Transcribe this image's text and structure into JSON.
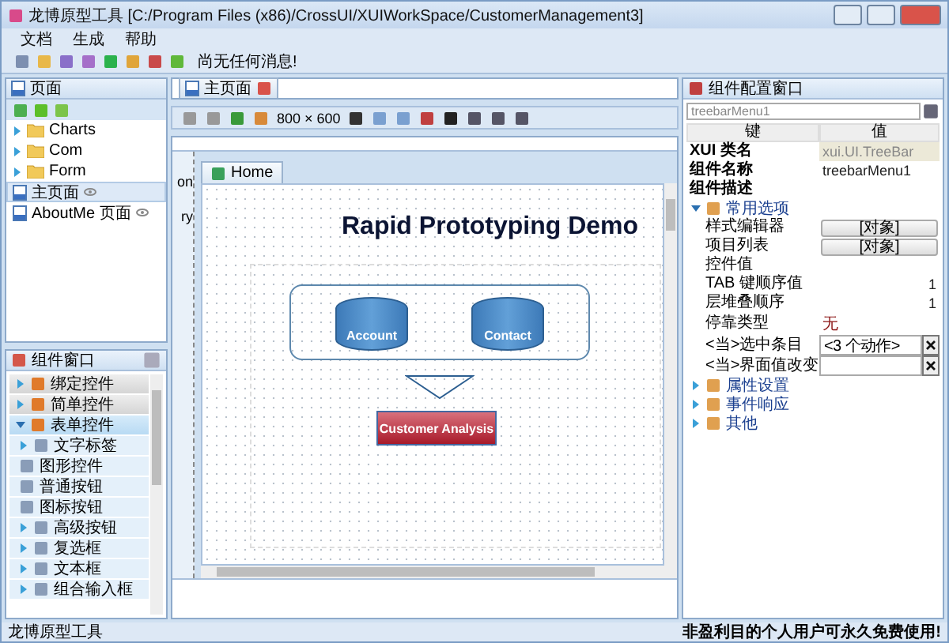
{
  "window": {
    "title": "龙博原型工具 [C:/Program Files (x86)/CrossUI/XUIWorkSpace/CustomerManagement3]"
  },
  "menu": [
    "文档",
    "生成",
    "帮助"
  ],
  "toolbar": {
    "message": "尚无任何消息!"
  },
  "pages_panel": {
    "title": "页面",
    "items": [
      {
        "kind": "folder",
        "label": "Charts",
        "expanded": false,
        "selected": false
      },
      {
        "kind": "folder",
        "label": "Com",
        "expanded": false,
        "selected": false
      },
      {
        "kind": "folder",
        "label": "Form",
        "expanded": false,
        "selected": false
      },
      {
        "kind": "page",
        "label": "主页面",
        "selected": true
      },
      {
        "kind": "page",
        "label": "AboutMe 页面",
        "selected": false
      }
    ]
  },
  "components_panel": {
    "title": "组件窗口",
    "items": [
      {
        "label": "绑定控件",
        "expanded": false
      },
      {
        "label": "简单控件",
        "expanded": false
      },
      {
        "label": "表单控件",
        "expanded": true,
        "children": [
          {
            "label": "文字标签",
            "expandable": true
          },
          {
            "label": "图形控件",
            "expandable": false
          },
          {
            "label": "普通按钮",
            "expandable": false
          },
          {
            "label": "图标按钮",
            "expandable": false
          },
          {
            "label": "高级按钮",
            "expandable": true
          },
          {
            "label": "复选框",
            "expandable": true
          },
          {
            "label": "文本框",
            "expandable": true
          },
          {
            "label": "组合输入框",
            "expandable": true
          }
        ]
      }
    ]
  },
  "editor": {
    "tab": "主页面",
    "size": "800 × 600",
    "side_labels": [
      "on",
      "ry"
    ],
    "page_tab": "Home",
    "canvas": {
      "title": "Rapid Prototyping Demo",
      "databases": [
        "Account",
        "Contact"
      ],
      "button": "Customer Analysis"
    }
  },
  "properties": {
    "title": "组件配置窗口",
    "search": "treebarMenu1",
    "columns": [
      "键",
      "值"
    ],
    "rows": [
      {
        "kind": "text",
        "key": "XUI 类名",
        "value": "xui.UI.TreeBar",
        "readonly": true
      },
      {
        "kind": "text",
        "key": "组件名称",
        "value": "treebarMenu1",
        "readonly": false
      },
      {
        "kind": "text",
        "key": "组件描述",
        "value": "",
        "readonly": false
      }
    ],
    "sections": [
      {
        "label": "常用选项",
        "expanded": true,
        "rows": [
          {
            "kind": "button",
            "key": "样式编辑器",
            "value": "[对象]"
          },
          {
            "kind": "button",
            "key": "项目列表",
            "value": "[对象]"
          },
          {
            "kind": "text",
            "key": "控件值",
            "value": ""
          },
          {
            "kind": "number",
            "key": "TAB 键顺序值",
            "value": "1"
          },
          {
            "kind": "number",
            "key": "层堆叠顺序",
            "value": "1"
          },
          {
            "kind": "mark",
            "key": "停靠类型",
            "value": "无"
          },
          {
            "kind": "picker",
            "key": "<当>选中条目",
            "value": "<3 个动作>"
          },
          {
            "kind": "picker",
            "key": "<当>界面值改变",
            "value": ""
          }
        ]
      },
      {
        "label": "属性设置",
        "expanded": false
      },
      {
        "label": "事件响应",
        "expanded": false
      },
      {
        "label": "其他",
        "expanded": false
      }
    ]
  },
  "status_bar": {
    "left": "龙博原型工具",
    "right": "非盈利目的个人用户可永久免费使用!"
  }
}
